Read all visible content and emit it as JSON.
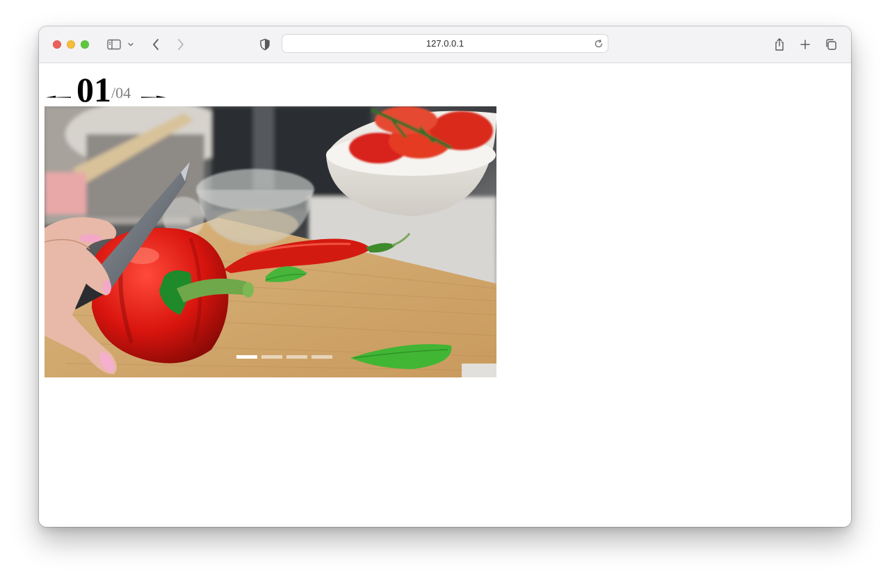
{
  "browser": {
    "url": "127.0.0.1",
    "icons": {
      "sidebar": "sidebar-icon",
      "chevron": "chevron-down-icon",
      "back": "back-arrow-icon",
      "forward": "forward-arrow-icon",
      "shield": "shield-icon",
      "reload": "reload-icon",
      "share": "share-icon",
      "new_tab": "plus-icon",
      "tabs": "tab-overview-icon"
    }
  },
  "slider": {
    "current": "01",
    "total": "/04",
    "slide_count": 4,
    "active_index": 0,
    "image_subject": "kitchen-photo"
  },
  "colors": {
    "counter_current": "#000000",
    "counter_total": "#808080",
    "dot_active": "#ffffff",
    "dot_inactive": "rgba(255,255,255,0.55)"
  }
}
